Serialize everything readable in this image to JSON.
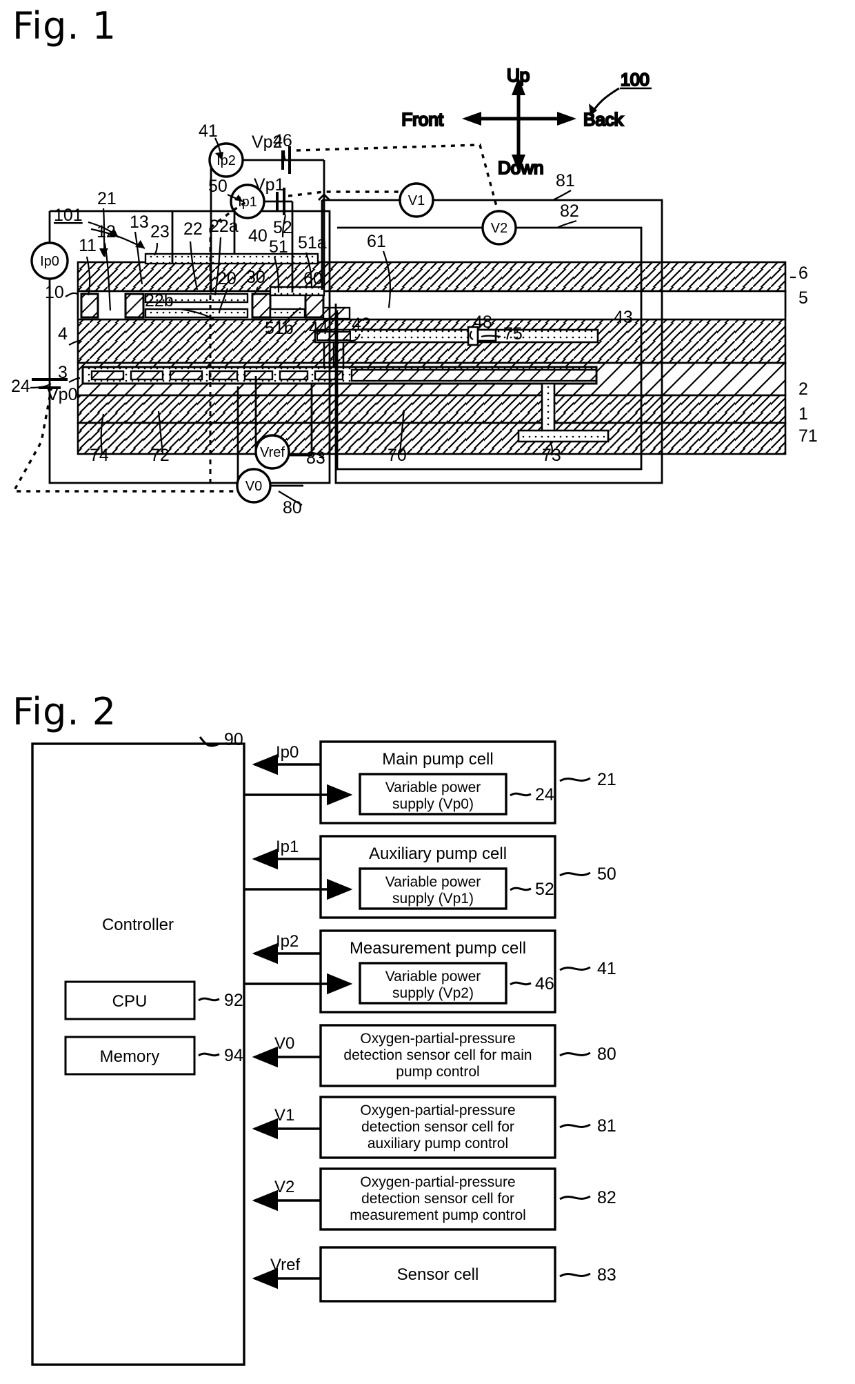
{
  "figures": {
    "fig1": {
      "title": "Fig. 1",
      "device_number": "100",
      "sensor_element_number": "101",
      "orientation": {
        "up": "Up",
        "down": "Down",
        "front": "Front",
        "back": "Back"
      },
      "meters": {
        "ip0": "Ip0",
        "ip1": "Ip1",
        "ip2": "Ip2",
        "v0": "V0",
        "v1": "V1",
        "v2": "V2",
        "vref": "Vref"
      },
      "supplies": {
        "vp0": "Vp0",
        "vp1": "Vp1",
        "vp2": "Vp2"
      },
      "callouts": [
        "100",
        "101",
        "21",
        "41",
        "50",
        "46",
        "52",
        "24",
        "11",
        "12",
        "13",
        "23",
        "22",
        "22a",
        "22b",
        "40",
        "51",
        "51a",
        "51b",
        "61",
        "10",
        "20",
        "30",
        "60",
        "44",
        "42",
        "48",
        "75",
        "43",
        "81",
        "82",
        "83",
        "80",
        "4",
        "3",
        "2",
        "1",
        "5",
        "6",
        "71",
        "70",
        "72",
        "73",
        "74"
      ]
    },
    "fig2": {
      "title": "Fig. 2",
      "controller": {
        "label": "Controller",
        "ref": "90",
        "cpu": {
          "label": "CPU",
          "ref": "92"
        },
        "memory": {
          "label": "Memory",
          "ref": "94"
        }
      },
      "rows": [
        {
          "signal": "Ip0",
          "block": "Main pump cell",
          "block_ref": "21",
          "sub": "Variable power supply (Vp0)",
          "sub_ref": "24",
          "has_sub": true
        },
        {
          "signal": "Ip1",
          "block": "Auxiliary pump cell",
          "block_ref": "50",
          "sub": "Variable power supply (Vp1)",
          "sub_ref": "52",
          "has_sub": true
        },
        {
          "signal": "Ip2",
          "block": "Measurement pump cell",
          "block_ref": "41",
          "sub": "Variable power supply (Vp2)",
          "sub_ref": "46",
          "has_sub": true
        },
        {
          "signal": "V0",
          "block": "Oxygen-partial-pressure detection sensor cell for main pump control",
          "block_ref": "80",
          "sub": "",
          "sub_ref": "",
          "has_sub": false
        },
        {
          "signal": "V1",
          "block": "Oxygen-partial-pressure detection sensor cell for auxiliary pump control",
          "block_ref": "81",
          "sub": "",
          "sub_ref": "",
          "has_sub": false
        },
        {
          "signal": "V2",
          "block": "Oxygen-partial-pressure detection sensor cell for measurement pump control",
          "block_ref": "82",
          "sub": "",
          "sub_ref": "",
          "has_sub": false
        },
        {
          "signal": "Vref",
          "block": "Sensor cell",
          "block_ref": "83",
          "sub": "",
          "sub_ref": "",
          "has_sub": false
        }
      ]
    }
  },
  "colors": {
    "ink": "#000000",
    "paper": "#ffffff"
  }
}
